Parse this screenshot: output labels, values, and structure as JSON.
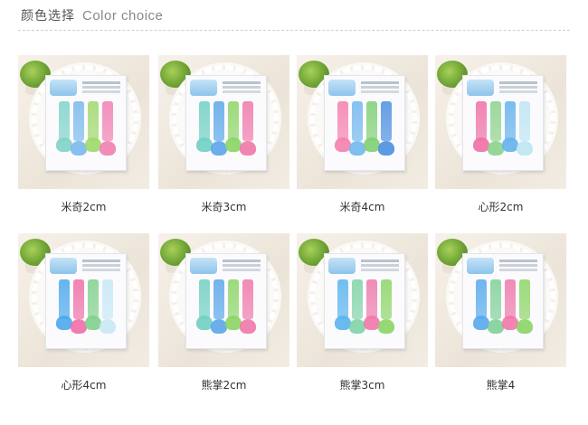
{
  "header": {
    "title_cn": "颜色选择",
    "title_en": "Color choice"
  },
  "products": [
    {
      "label": "米奇2cm",
      "colors": [
        "#7fd3c8",
        "#7ab8ec",
        "#9fd86a",
        "#f07fb0"
      ]
    },
    {
      "label": "米奇3cm",
      "colors": [
        "#6fd0c4",
        "#5aa6ea",
        "#8bd565",
        "#ef78aa"
      ]
    },
    {
      "label": "米奇4cm",
      "colors": [
        "#f57fae",
        "#72b6ee",
        "#7fcf73",
        "#4a8fe0"
      ]
    },
    {
      "label": "心形2cm",
      "colors": [
        "#ef6fa5",
        "#8bd28c",
        "#63b2ec",
        "#bde5f3"
      ]
    },
    {
      "label": "心形4cm",
      "colors": [
        "#4aa8ec",
        "#f06ea8",
        "#7fd08c",
        "#c8e8f4"
      ]
    },
    {
      "label": "熊掌2cm",
      "colors": [
        "#70cfc2",
        "#5aa6ea",
        "#8bd565",
        "#ef78aa"
      ]
    },
    {
      "label": "熊掌3cm",
      "colors": [
        "#5ab3ee",
        "#7fd3a6",
        "#ef78aa",
        "#8bd565"
      ]
    },
    {
      "label": "熊掌4",
      "colors": [
        "#56a9ec",
        "#7fd098",
        "#ef78aa",
        "#8bd565"
      ]
    }
  ]
}
